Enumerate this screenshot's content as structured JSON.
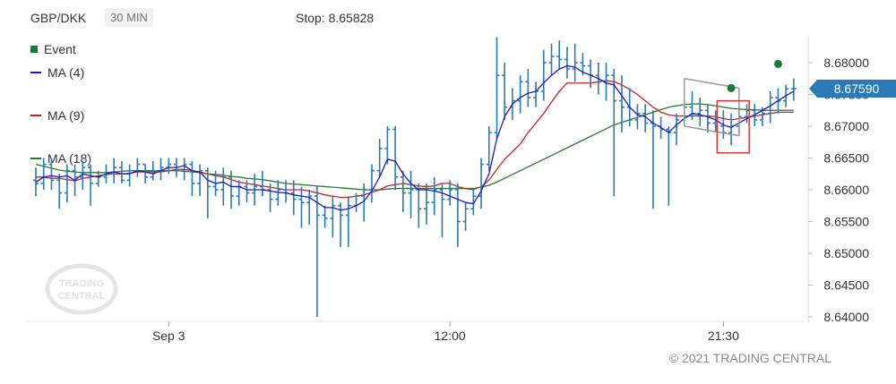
{
  "header": {
    "symbol": "GBP/DKK",
    "timeframe": "30 MIN",
    "stop_label": "Stop: 8.65828"
  },
  "legend": [
    {
      "label": "Event",
      "color": "#1a7a3a",
      "kind": "dot"
    },
    {
      "label": "MA (4)",
      "color": "#1a1acc",
      "kind": "line"
    },
    {
      "label": "MA (9)",
      "color": "#cc2222",
      "kind": "line"
    },
    {
      "label": "MA (18)",
      "color": "#2a7a2a",
      "kind": "line"
    }
  ],
  "watermark": {
    "line1": "TRADING",
    "line2": "CENTRAL"
  },
  "copyright": "© 2021 TRADING CENTRAL",
  "colors": {
    "bars": "#2a7ab8",
    "price_tag": "#2a7ab8",
    "pattern": "#999999",
    "stop_box": "#e03030",
    "event": "#1a7a3a"
  },
  "chart_data": {
    "type": "ohlc",
    "ylim": [
      8.64,
      8.685
    ],
    "y_ticks": [
      "8.68000",
      "8.67500",
      "8.67000",
      "8.66500",
      "8.66000",
      "8.65500",
      "8.65000",
      "8.64500",
      "8.64000"
    ],
    "x_ticks": [
      {
        "label": "Sep 3",
        "index": 17
      },
      {
        "label": "12:00",
        "index": 53
      },
      {
        "label": "21:30",
        "index": 88
      }
    ],
    "current_price": "8.67590",
    "stop": 8.65828,
    "bars": [
      [
        8.6615,
        8.6635,
        8.659,
        8.661
      ],
      [
        8.661,
        8.665,
        8.66,
        8.664
      ],
      [
        8.664,
        8.665,
        8.66,
        8.6615
      ],
      [
        8.6615,
        8.6625,
        8.657,
        8.6595
      ],
      [
        8.6595,
        8.664,
        8.658,
        8.663
      ],
      [
        8.663,
        8.664,
        8.659,
        8.662
      ],
      [
        8.662,
        8.6645,
        8.66,
        8.6635
      ],
      [
        8.6635,
        8.664,
        8.6575,
        8.661
      ],
      [
        8.661,
        8.663,
        8.6605,
        8.662
      ],
      [
        8.662,
        8.664,
        8.661,
        8.6625
      ],
      [
        8.6625,
        8.665,
        8.661,
        8.6635
      ],
      [
        8.6635,
        8.6645,
        8.661,
        8.6615
      ],
      [
        8.6615,
        8.664,
        8.6605,
        8.663
      ],
      [
        8.663,
        8.665,
        8.662,
        8.664
      ],
      [
        8.664,
        8.664,
        8.661,
        8.662
      ],
      [
        8.662,
        8.6645,
        8.6615,
        8.663
      ],
      [
        8.663,
        8.665,
        8.6615,
        8.6635
      ],
      [
        8.6635,
        8.665,
        8.6625,
        8.664
      ],
      [
        8.664,
        8.665,
        8.662,
        8.663
      ],
      [
        8.663,
        8.665,
        8.6615,
        8.664
      ],
      [
        8.664,
        8.6645,
        8.659,
        8.661
      ],
      [
        8.661,
        8.664,
        8.659,
        8.663
      ],
      [
        8.663,
        8.6635,
        8.6555,
        8.6605
      ],
      [
        8.6605,
        8.663,
        8.659,
        8.66
      ],
      [
        8.66,
        8.6635,
        8.6575,
        8.662
      ],
      [
        8.662,
        8.663,
        8.657,
        8.659
      ],
      [
        8.659,
        8.6615,
        8.6575,
        8.6605
      ],
      [
        8.6605,
        8.6615,
        8.658,
        8.6595
      ],
      [
        8.6595,
        8.6625,
        8.6575,
        8.6605
      ],
      [
        8.6605,
        8.663,
        8.659,
        8.66
      ],
      [
        8.66,
        8.661,
        8.6565,
        8.6585
      ],
      [
        8.6585,
        8.6615,
        8.6575,
        8.66
      ],
      [
        8.66,
        8.6615,
        8.658,
        8.6595
      ],
      [
        8.6595,
        8.6615,
        8.656,
        8.6585
      ],
      [
        8.6585,
        8.6605,
        8.654,
        8.658
      ],
      [
        8.658,
        8.66,
        8.6545,
        8.659
      ],
      [
        8.659,
        8.6605,
        8.64,
        8.656
      ],
      [
        8.656,
        8.6575,
        8.654,
        8.6555
      ],
      [
        8.6555,
        8.659,
        8.6525,
        8.6575
      ],
      [
        8.6575,
        8.658,
        8.651,
        8.656
      ],
      [
        8.656,
        8.659,
        8.651,
        8.6575
      ],
      [
        8.6575,
        8.6595,
        8.6565,
        8.659
      ],
      [
        8.659,
        8.661,
        8.655,
        8.66
      ],
      [
        8.66,
        8.664,
        8.658,
        8.663
      ],
      [
        8.663,
        8.668,
        8.662,
        8.6665
      ],
      [
        8.6665,
        8.67,
        8.664,
        8.6695
      ],
      [
        8.6695,
        8.67,
        8.66,
        8.662
      ],
      [
        8.662,
        8.663,
        8.6565,
        8.6595
      ],
      [
        8.6595,
        8.663,
        8.6555,
        8.66
      ],
      [
        8.66,
        8.661,
        8.654,
        8.657
      ],
      [
        8.657,
        8.661,
        8.6545,
        8.658
      ],
      [
        8.658,
        8.662,
        8.656,
        8.66
      ],
      [
        8.66,
        8.661,
        8.6525,
        8.6585
      ],
      [
        8.6585,
        8.6615,
        8.6575,
        8.66
      ],
      [
        8.66,
        8.661,
        8.651,
        8.655
      ],
      [
        8.655,
        8.658,
        8.6535,
        8.657
      ],
      [
        8.657,
        8.66,
        8.656,
        8.659
      ],
      [
        8.659,
        8.665,
        8.657,
        8.664
      ],
      [
        8.664,
        8.67,
        8.663,
        8.669
      ],
      [
        8.669,
        8.684,
        8.668,
        8.678
      ],
      [
        8.678,
        8.68,
        8.671,
        8.673
      ],
      [
        8.673,
        8.676,
        8.671,
        8.674
      ],
      [
        8.674,
        8.678,
        8.672,
        8.677
      ],
      [
        8.677,
        8.679,
        8.673,
        8.6745
      ],
      [
        8.6745,
        8.677,
        8.673,
        8.6755
      ],
      [
        8.6755,
        8.682,
        8.674,
        8.68
      ],
      [
        8.68,
        8.683,
        8.678,
        8.681
      ],
      [
        8.681,
        8.6835,
        8.679,
        8.6805
      ],
      [
        8.6805,
        8.6825,
        8.6775,
        8.679
      ],
      [
        8.679,
        8.683,
        8.677,
        8.68
      ],
      [
        8.68,
        8.6815,
        8.678,
        8.6795
      ],
      [
        8.6795,
        8.6805,
        8.676,
        8.678
      ],
      [
        8.678,
        8.68,
        8.675,
        8.677
      ],
      [
        8.677,
        8.68,
        8.674,
        8.678
      ],
      [
        8.678,
        8.679,
        8.659,
        8.674
      ],
      [
        8.674,
        8.678,
        8.669,
        8.673
      ],
      [
        8.673,
        8.676,
        8.67,
        8.671
      ],
      [
        8.671,
        8.6735,
        8.6695,
        8.672
      ],
      [
        8.672,
        8.6735,
        8.669,
        8.6705
      ],
      [
        8.6705,
        8.6725,
        8.657,
        8.67
      ],
      [
        8.67,
        8.6715,
        8.668,
        8.6695
      ],
      [
        8.6695,
        8.67,
        8.6575,
        8.669
      ],
      [
        8.669,
        8.672,
        8.667,
        8.671
      ],
      [
        8.671,
        8.674,
        8.67,
        8.673
      ],
      [
        8.673,
        8.6755,
        8.671,
        8.672
      ],
      [
        8.672,
        8.6745,
        8.67,
        8.6725
      ],
      [
        8.6725,
        8.6735,
        8.669,
        8.6705
      ],
      [
        8.6705,
        8.6725,
        8.669,
        8.67
      ],
      [
        8.67,
        8.6725,
        8.668,
        8.669
      ],
      [
        8.669,
        8.672,
        8.667,
        8.67
      ],
      [
        8.67,
        8.673,
        8.6685,
        8.6715
      ],
      [
        8.6715,
        8.6735,
        8.6705,
        8.6725
      ],
      [
        8.6725,
        8.6735,
        8.67,
        8.671
      ],
      [
        8.671,
        8.673,
        8.67,
        8.672
      ],
      [
        8.672,
        8.6755,
        8.6705,
        8.6745
      ],
      [
        8.6745,
        8.676,
        8.672,
        8.674
      ],
      [
        8.674,
        8.6765,
        8.673,
        8.6759
      ],
      [
        8.6759,
        8.6775,
        8.674,
        8.6759
      ]
    ],
    "events": [
      {
        "index": 89,
        "price": 8.676
      },
      {
        "index": 95,
        "price": 8.6798
      }
    ],
    "ma4": [
      8.6612,
      8.662,
      8.6622,
      8.662,
      8.6622,
      8.6615,
      8.6625,
      8.6622,
      8.662,
      8.6625,
      8.6628,
      8.6625,
      8.6625,
      8.663,
      8.6628,
      8.6625,
      8.663,
      8.6635,
      8.6635,
      8.6638,
      8.663,
      8.6628,
      8.6615,
      8.661,
      8.6612,
      8.6605,
      8.6605,
      8.66,
      8.66,
      8.66,
      8.6598,
      8.6596,
      8.6595,
      8.6592,
      8.659,
      8.6588,
      8.658,
      8.6572,
      8.6572,
      8.6568,
      8.657,
      8.6575,
      8.6582,
      8.6598,
      8.662,
      8.6648,
      8.6645,
      8.6625,
      8.661,
      8.66,
      8.66,
      8.6598,
      8.6595,
      8.659,
      8.6585,
      8.658,
      8.6578,
      8.6598,
      8.6625,
      8.668,
      8.6715,
      8.6735,
      8.6745,
      8.6752,
      8.6755,
      8.6768,
      8.678,
      8.679,
      8.6795,
      8.6793,
      8.6785,
      8.678,
      8.6775,
      8.6768,
      8.6765,
      8.6748,
      8.673,
      8.6718,
      8.6715,
      8.6705,
      8.6698,
      8.669,
      8.6702,
      8.6712,
      8.672,
      8.6718,
      8.6715,
      8.671,
      8.6702,
      8.6698,
      8.6705,
      8.6712,
      8.6718,
      8.6725,
      8.6732,
      8.674,
      8.6748,
      8.6755
    ],
    "ma9": [
      8.662,
      8.662,
      8.6618,
      8.6618,
      8.6616,
      8.6614,
      8.6618,
      8.662,
      8.6622,
      8.6624,
      8.6625,
      8.6625,
      8.6626,
      8.6628,
      8.6628,
      8.6628,
      8.6628,
      8.663,
      8.6632,
      8.6632,
      8.663,
      8.6628,
      8.6625,
      8.6622,
      8.662,
      8.6616,
      8.6612,
      8.661,
      8.6608,
      8.6606,
      8.6604,
      8.6602,
      8.66,
      8.66,
      8.66,
      8.6598,
      8.6595,
      8.6592,
      8.659,
      8.6588,
      8.6588,
      8.659,
      8.6592,
      8.6596,
      8.66,
      8.6606,
      8.6608,
      8.661,
      8.6608,
      8.6606,
      8.6605,
      8.6606,
      8.661,
      8.661,
      8.6605,
      8.6602,
      8.66,
      8.6605,
      8.6615,
      8.6632,
      8.6648,
      8.666,
      8.6672,
      8.669,
      8.6705,
      8.672,
      8.6738,
      8.6755,
      8.6768,
      8.6768,
      8.6768,
      8.6768,
      8.677,
      8.6772,
      8.677,
      8.6765,
      8.6758,
      8.675,
      8.674,
      8.673,
      8.6722,
      8.6718,
      8.6716,
      8.6716,
      8.6716,
      8.6716,
      8.6716,
      8.6715,
      8.6712,
      8.671,
      8.6712,
      8.6714,
      8.6716,
      8.6718,
      8.672,
      8.6722,
      8.6722,
      8.6722
    ],
    "ma18": [
      8.664,
      8.6637,
      8.6634,
      8.6631,
      8.6629,
      8.6628,
      8.6627,
      8.6627,
      8.6627,
      8.6627,
      8.6628,
      8.6629,
      8.663,
      8.663,
      8.663,
      8.663,
      8.663,
      8.663,
      8.663,
      8.6629,
      8.6628,
      8.6627,
      8.6625,
      8.6624,
      8.6623,
      8.6621,
      8.662,
      8.6618,
      8.6617,
      8.6616,
      8.6614,
      8.6612,
      8.661,
      8.6609,
      8.6608,
      8.6607,
      8.6606,
      8.6605,
      8.6604,
      8.6603,
      8.6602,
      8.6601,
      8.66,
      8.66,
      8.66,
      8.6601,
      8.6602,
      8.6602,
      8.6602,
      8.6602,
      8.6602,
      8.6602,
      8.6602,
      8.6602,
      8.6602,
      8.6602,
      8.6602,
      8.6604,
      8.6607,
      8.6612,
      8.6618,
      8.6624,
      8.663,
      8.6636,
      8.6642,
      8.6648,
      8.6654,
      8.666,
      8.6666,
      8.6672,
      8.6678,
      8.6684,
      8.669,
      8.6696,
      8.6702,
      8.6706,
      8.671,
      8.6714,
      8.6718,
      8.6722,
      8.6726,
      8.673,
      8.6732,
      8.6734,
      8.6735,
      8.6735,
      8.6734,
      8.6732,
      8.673,
      8.6728,
      8.6727,
      8.6726,
      8.6726,
      8.6725,
      8.6725,
      8.6725,
      8.6725,
      8.6725
    ]
  }
}
